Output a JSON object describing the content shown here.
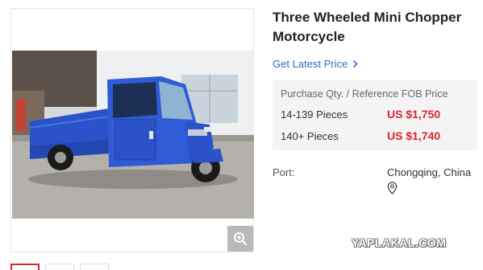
{
  "product": {
    "title": "Three Wheeled Mini Chopper Motorcycle",
    "latest_price_link": "Get Latest Price"
  },
  "price_table": {
    "header": "Purchase Qty. / Reference FOB Price",
    "rows": [
      {
        "qty": "14-139 Pieces",
        "price": "US $1,750"
      },
      {
        "qty": "140+ Pieces",
        "price": "US $1,740"
      }
    ]
  },
  "port": {
    "label": "Port:",
    "value": "Chongqing, China"
  },
  "watermark": "YAPLAKAL.COM",
  "colors": {
    "accent_red": "#d8272d",
    "link_blue": "#2d6fc4",
    "vehicle_blue": "#2a52c9"
  },
  "icons": {
    "zoom": "zoom-in-icon",
    "chevron": "chevron-right-icon",
    "pin": "map-pin-icon"
  }
}
